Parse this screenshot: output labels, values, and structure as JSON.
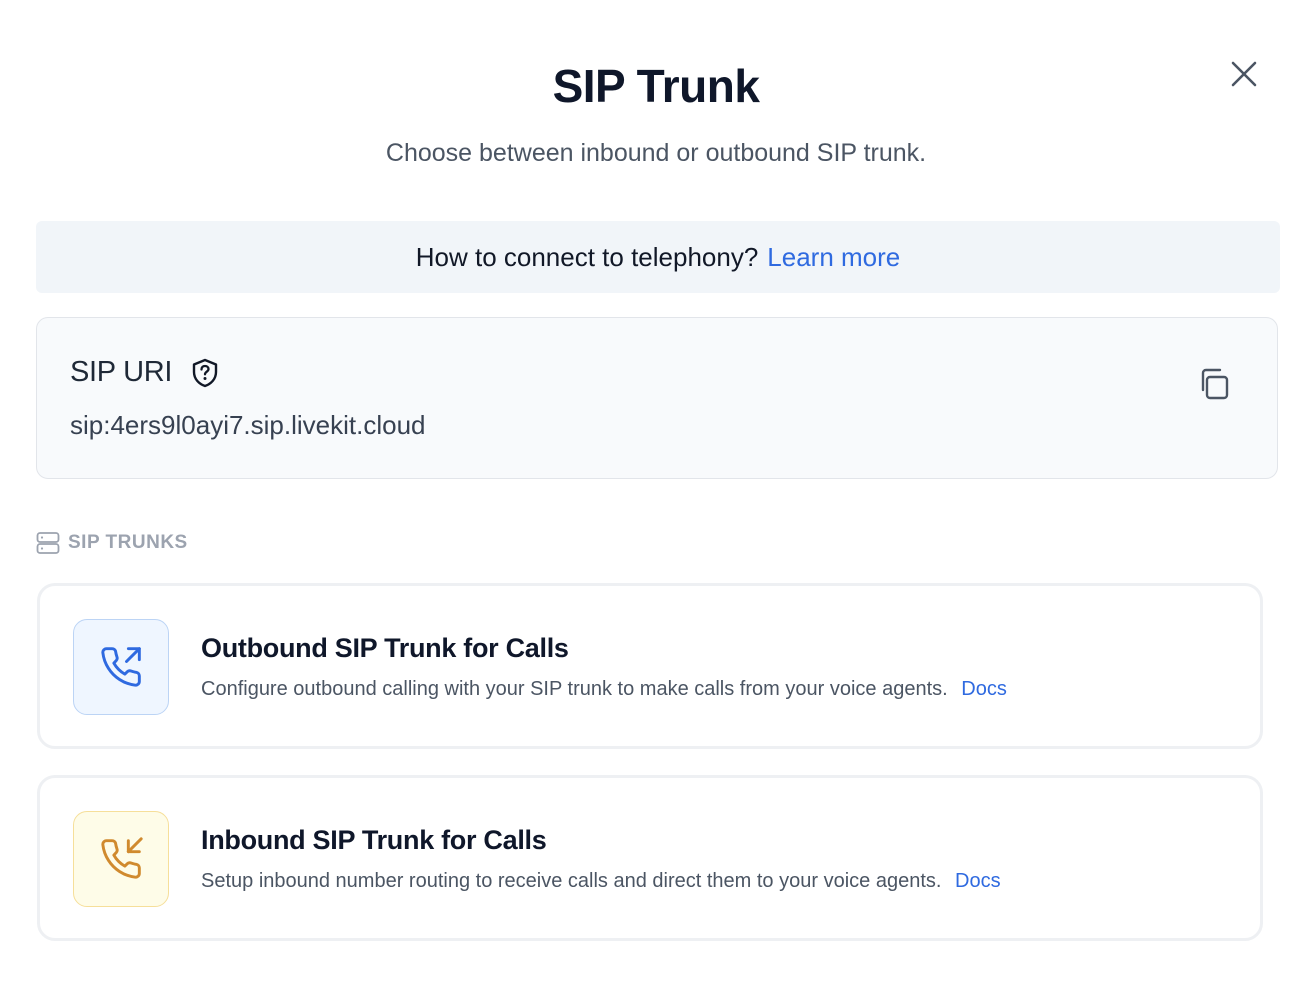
{
  "modal": {
    "title": "SIP Trunk",
    "subtitle": "Choose between inbound or outbound SIP trunk.",
    "close_icon": "close-icon"
  },
  "help_banner": {
    "text": "How to connect to telephony?",
    "link_label": "Learn more"
  },
  "sip_uri": {
    "label": "SIP URI",
    "help_icon": "shield-question-icon",
    "value": "sip:4ers9l0ayi7.sip.livekit.cloud",
    "copy_icon": "copy-icon"
  },
  "section": {
    "label": "SIP TRUNKS",
    "icon": "server-icon"
  },
  "trunks": [
    {
      "title": "Outbound SIP Trunk for Calls",
      "description": "Configure outbound calling with your SIP trunk to make calls from your voice agents.",
      "docs_label": "Docs",
      "icon": "phone-outgoing-icon",
      "accent": "#2f6ae0"
    },
    {
      "title": "Inbound SIP Trunk for Calls",
      "description": "Setup inbound number routing to receive calls and direct them to your voice agents.",
      "docs_label": "Docs",
      "icon": "phone-incoming-icon",
      "accent": "#d08a2e"
    }
  ]
}
